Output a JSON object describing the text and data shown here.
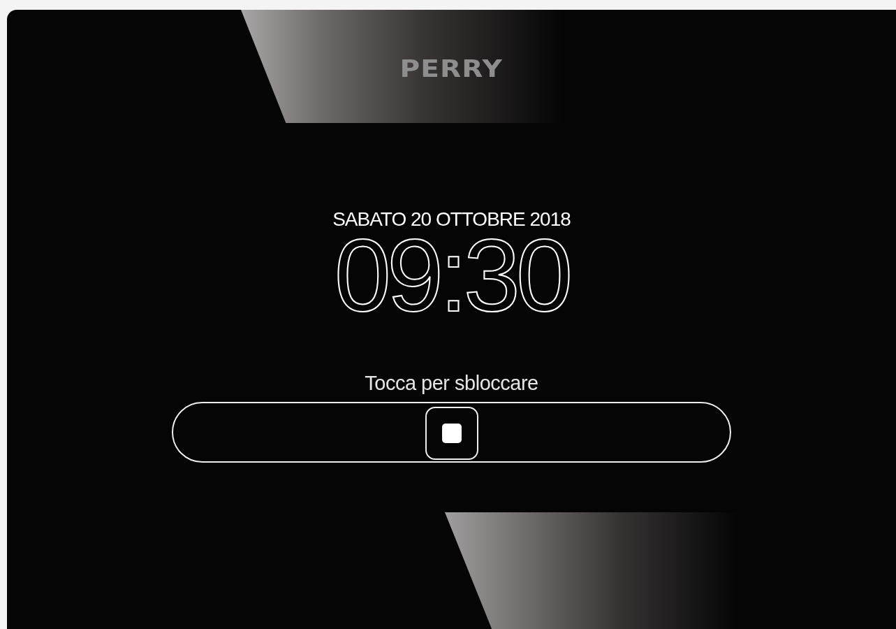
{
  "logo": "PERRY",
  "date": "SABATO 20 OTTOBRE 2018",
  "time": "09:30",
  "unlock": {
    "label": "Tocca per sbloccare",
    "level": 0.5
  }
}
